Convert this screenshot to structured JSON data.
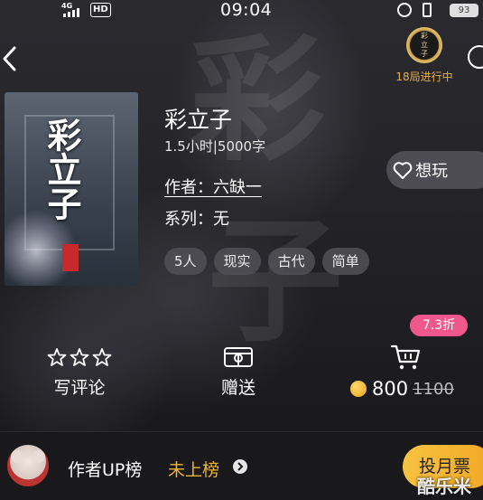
{
  "status_bar": {
    "network": "4G",
    "hd": "HD",
    "time": "09:04",
    "battery": "93"
  },
  "header": {
    "badge_medal_text": "彩\n立\n子",
    "badge_label": "18局进行中"
  },
  "book": {
    "cover_title": "彩立子",
    "cover_stamp": "六缺一著",
    "title": "彩立子",
    "meta": "1.5小时|5000字",
    "author": "作者：六缺一",
    "series": "系列：无",
    "tags": [
      "5人",
      "现实",
      "古代",
      "简单"
    ]
  },
  "want_button": {
    "label": "想玩"
  },
  "actions": {
    "review_label": "写评论",
    "gift_label": "赠送",
    "discount": "7.3折",
    "price_now": "800",
    "price_old": "1100"
  },
  "bottom": {
    "rank_label": "作者UP榜",
    "rank_status": "未上榜",
    "vote_label": "投月票"
  },
  "watermark": "酷乐米",
  "colors": {
    "accent_gold": "#f0b433",
    "discount_pink": "#f0588b",
    "background": "#1b1b1f"
  }
}
